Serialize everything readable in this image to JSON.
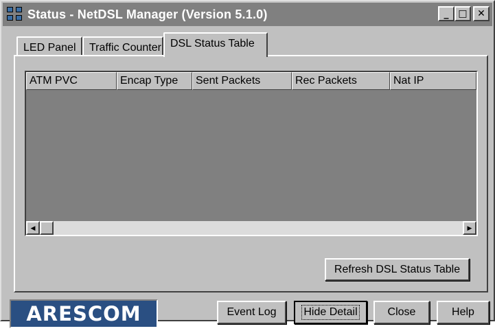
{
  "window": {
    "title": "Status - NetDSL Manager (Version 5.1.0)",
    "controls": {
      "minimize": "_",
      "maximize": "□",
      "close": "✕"
    }
  },
  "tabs": [
    {
      "label": "LED Panel",
      "selected": false
    },
    {
      "label": "Traffic Counter",
      "selected": false
    },
    {
      "label": "DSL Status Table",
      "selected": true
    }
  ],
  "table": {
    "columns": [
      "ATM PVC",
      "Encap Type",
      "Sent Packets",
      "Rec Packets",
      "Nat IP"
    ],
    "rows": []
  },
  "buttons": {
    "refresh": "Refresh DSL Status Table",
    "event_log": "Event Log",
    "hide_detail": "Hide Detail",
    "close": "Close",
    "help": "Help"
  },
  "logo": {
    "text": "ARESCOM"
  },
  "colors": {
    "titlebar": "#808080",
    "face": "#c0c0c0",
    "table_background": "#808080",
    "logo_background": "#2a4f82"
  },
  "icons": {
    "app": "network-computers-icon",
    "scroll_left": "arrow-left-icon",
    "scroll_right": "arrow-right-icon"
  }
}
